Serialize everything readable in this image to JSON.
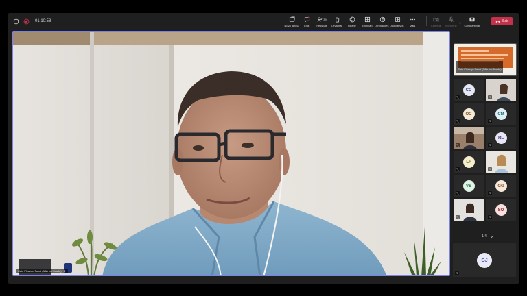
{
  "topbar": {
    "timer": "01:10:58",
    "tools": [
      {
        "label": "Nova janela",
        "icon": "new-window-icon"
      },
      {
        "label": "Chat",
        "icon": "chat-icon"
      },
      {
        "label": "Pessoas",
        "icon": "people-icon",
        "badge": "39"
      },
      {
        "label": "Levantar",
        "icon": "raise-hand-icon"
      },
      {
        "label": "Reagir",
        "icon": "react-icon"
      },
      {
        "label": "Exibição",
        "icon": "view-icon"
      },
      {
        "label": "Anotações",
        "icon": "notes-icon"
      },
      {
        "label": "Aplicativos",
        "icon": "apps-icon"
      },
      {
        "label": "Mais",
        "icon": "more-icon"
      }
    ],
    "media_tools": [
      {
        "label": "Câmera",
        "icon": "camera-off-icon"
      },
      {
        "label": "Microfone",
        "icon": "mic-off-icon"
      },
      {
        "label": "Compartilhar",
        "icon": "share-icon"
      }
    ],
    "leave_label": "Sair"
  },
  "main": {
    "name_tag": "Caio Picanço Facci (Não verificado)"
  },
  "gallery": {
    "shared_caption": "Caio Picanço Facci (Não verificado)",
    "tiles": [
      {
        "initials": "CC"
      },
      {
        "initials": ""
      },
      {
        "initials": "OC"
      },
      {
        "initials": "CM"
      },
      {
        "initials": ""
      },
      {
        "initials": "RL"
      },
      {
        "initials": "LF"
      },
      {
        "initials": ""
      },
      {
        "initials": "VS"
      },
      {
        "initials": "GG"
      },
      {
        "initials": ""
      },
      {
        "initials": "SO"
      }
    ],
    "page": "1/4",
    "big_tile_initials": "GJ"
  },
  "colors": {
    "accent": "#7b83eb",
    "leave": "#c4314b",
    "window": "#1f1f1f",
    "tile": "#292929"
  }
}
